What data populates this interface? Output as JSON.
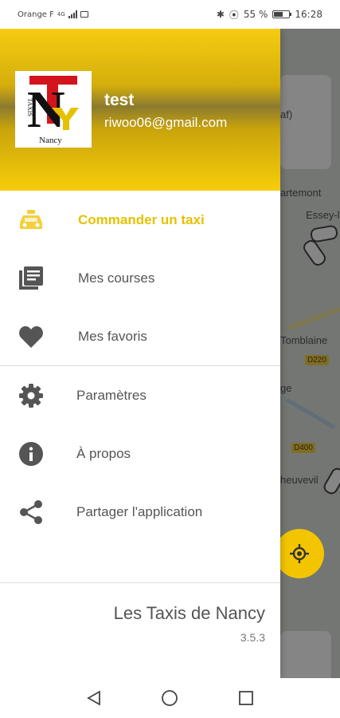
{
  "status_bar": {
    "carrier": "Orange F",
    "network": "4G",
    "battery": "55 %",
    "time": "16:28"
  },
  "drawer": {
    "header": {
      "user_name": "test",
      "user_email": "riwoo06@gmail.com",
      "logo": {
        "main_letters": "TNY",
        "side_text": "TAXIS",
        "bottom_text": "Nancy"
      }
    },
    "menu": [
      {
        "label": "Commander un taxi",
        "icon": "taxi-icon",
        "active": true
      },
      {
        "label": "Mes courses",
        "icon": "list-icon",
        "active": false
      },
      {
        "label": "Mes favoris",
        "icon": "heart-icon",
        "active": false
      },
      {
        "label": "Paramètres",
        "icon": "gear-icon",
        "active": false
      },
      {
        "label": "À propos",
        "icon": "info-icon",
        "active": false
      },
      {
        "label": "Partager l'application",
        "icon": "share-icon",
        "active": false
      }
    ],
    "footer": {
      "app_name": "Les Taxis de Nancy",
      "version": "3.5.3"
    }
  },
  "map": {
    "labels": [
      "af)",
      "artemont",
      "Essey-l",
      "Tomblaine",
      "ge",
      "heuvevil"
    ],
    "road_badges": [
      "D220",
      "D400"
    ]
  },
  "colors": {
    "accent": "#f3c500",
    "active_label": "#e6c100",
    "icon_gray": "#555555"
  }
}
